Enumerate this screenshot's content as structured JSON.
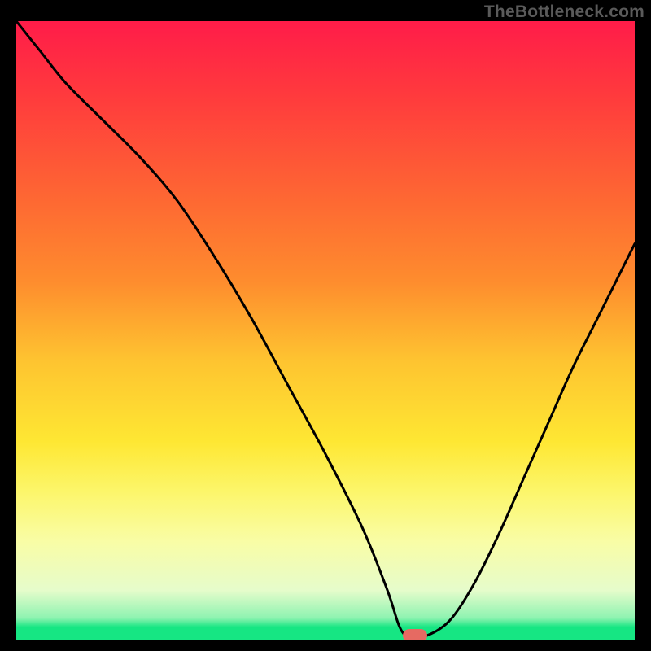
{
  "watermark": "TheBottleneck.com",
  "colors": {
    "top": "#FF1C49",
    "mid_upper": "#FE8C2E",
    "mid": "#FEE733",
    "low": "#F9FDA5",
    "band_pale": "#E6FCCB",
    "green": "#16E683",
    "marker": "#E66A62",
    "curve": "#000000",
    "frame": "#000000"
  },
  "chart_data": {
    "type": "line",
    "title": "",
    "xlabel": "",
    "ylabel": "",
    "xlim": [
      0,
      100
    ],
    "ylim": [
      0,
      100
    ],
    "gradient_bands": [
      {
        "from": 0,
        "to": 10,
        "color_top": "#FF1C49",
        "note": "red"
      },
      {
        "from": 10,
        "to": 60,
        "color_top": "#FE8C2E",
        "note": "orange"
      },
      {
        "from": 60,
        "to": 78,
        "color_top": "#FEE733",
        "note": "yellow"
      },
      {
        "from": 78,
        "to": 90,
        "color_top": "#F9FDA5",
        "note": "pale yellow"
      },
      {
        "from": 90,
        "to": 97,
        "color_top": "#E6FCCB",
        "note": "pale green band"
      },
      {
        "from": 97,
        "to": 100,
        "color_top": "#16E683",
        "note": "green"
      }
    ],
    "series": [
      {
        "name": "bottleneck-curve",
        "x": [
          0,
          4,
          8,
          14,
          20,
          26,
          32,
          38,
          44,
          50,
          56,
          60,
          62,
          63.5,
          66,
          70,
          74,
          78,
          82,
          86,
          90,
          94,
          98,
          100
        ],
        "y_pct": [
          100,
          95,
          90,
          84,
          78,
          71,
          62,
          52,
          41,
          30,
          18,
          8,
          2,
          0.5,
          0.5,
          3,
          9,
          17,
          26,
          35,
          44,
          52,
          60,
          64
        ]
      }
    ],
    "marker": {
      "x": 64.5,
      "y_pct": 0.7
    },
    "notes": "y_pct is percent of plot height from bottom (0 = bottom green strip, 100 = top). x is percent of plot width from left. The curve is a V-shaped bottleneck curve with a flat minimum around x≈62–66 and a left shoulder/kink near x≈20–26 where the slope steepens."
  }
}
